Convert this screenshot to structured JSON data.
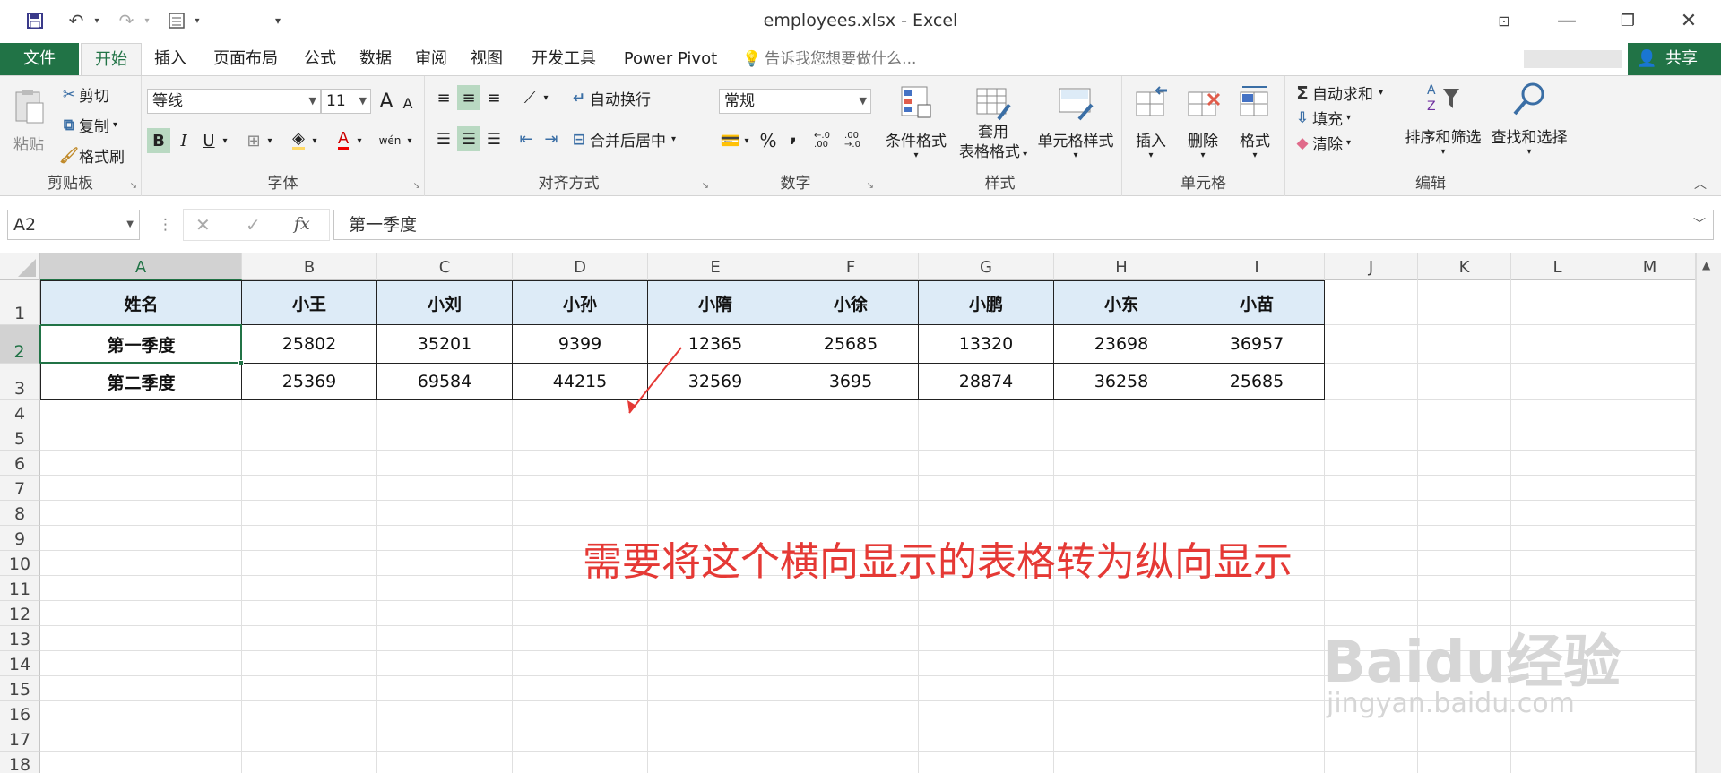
{
  "window": {
    "title": "employees.xlsx - Excel"
  },
  "quick_access": {
    "save": "save-icon",
    "undo": "undo-icon",
    "redo": "redo-icon",
    "form": "form-icon",
    "customize": "customize-icon"
  },
  "tabs": [
    {
      "label": "文件"
    },
    {
      "label": "开始"
    },
    {
      "label": "插入"
    },
    {
      "label": "页面布局"
    },
    {
      "label": "公式"
    },
    {
      "label": "数据"
    },
    {
      "label": "审阅"
    },
    {
      "label": "视图"
    },
    {
      "label": "开发工具"
    },
    {
      "label": "Power Pivot"
    }
  ],
  "tellme": "告诉我您想要做什么...",
  "share": "共享",
  "ribbon": {
    "clipboard": {
      "label": "剪贴板",
      "paste": "粘贴",
      "cut": "剪切",
      "copy": "复制",
      "painter": "格式刷"
    },
    "font": {
      "label": "字体",
      "name": "等线",
      "size": "11",
      "bold": "B",
      "italic": "I",
      "underline": "U",
      "grow": "A",
      "shrink": "A",
      "pinyin": "wén"
    },
    "alignment": {
      "label": "对齐方式",
      "wrap": "自动换行",
      "merge": "合并后居中"
    },
    "number": {
      "label": "数字",
      "format": "常规",
      "percent": "%",
      "comma": ","
    },
    "styles": {
      "label": "样式",
      "conditional": "条件格式",
      "table_line1": "套用",
      "table_line2": "表格格式",
      "cell_styles": "单元格样式"
    },
    "cells": {
      "label": "单元格",
      "insert": "插入",
      "delete": "删除",
      "format": "格式"
    },
    "editing": {
      "label": "编辑",
      "autosum": "自动求和",
      "fill": "填充",
      "clear": "清除",
      "sort": "排序和筛选",
      "find": "查找和选择"
    }
  },
  "formula_bar": {
    "name_box": "A2",
    "fx": "fx",
    "value": "第一季度"
  },
  "columns": [
    "A",
    "B",
    "C",
    "D",
    "E",
    "F",
    "G",
    "H",
    "I",
    "J",
    "K",
    "L",
    "M"
  ],
  "rows": [
    "1",
    "2",
    "3",
    "4",
    "5",
    "6",
    "7",
    "8",
    "9",
    "10",
    "11",
    "12",
    "13",
    "14",
    "15",
    "16",
    "17",
    "18"
  ],
  "table": {
    "header": [
      "姓名",
      "小王",
      "小刘",
      "小孙",
      "小隋",
      "小徐",
      "小鹏",
      "小东",
      "小苗"
    ],
    "rows": [
      [
        "第一季度",
        "25802",
        "35201",
        "9399",
        "12365",
        "25685",
        "13320",
        "23698",
        "36957"
      ],
      [
        "第二季度",
        "25369",
        "69584",
        "44215",
        "32569",
        "3695",
        "28874",
        "36258",
        "25685"
      ]
    ]
  },
  "annotation": "需要将这个横向显示的表格转为纵向显示",
  "watermark": {
    "line1": "Baidu经验",
    "line2": "jingyan.baidu.com"
  },
  "colors": {
    "accent": "#217346",
    "header_fill": "#ddebf7",
    "annotation": "#e53935"
  }
}
